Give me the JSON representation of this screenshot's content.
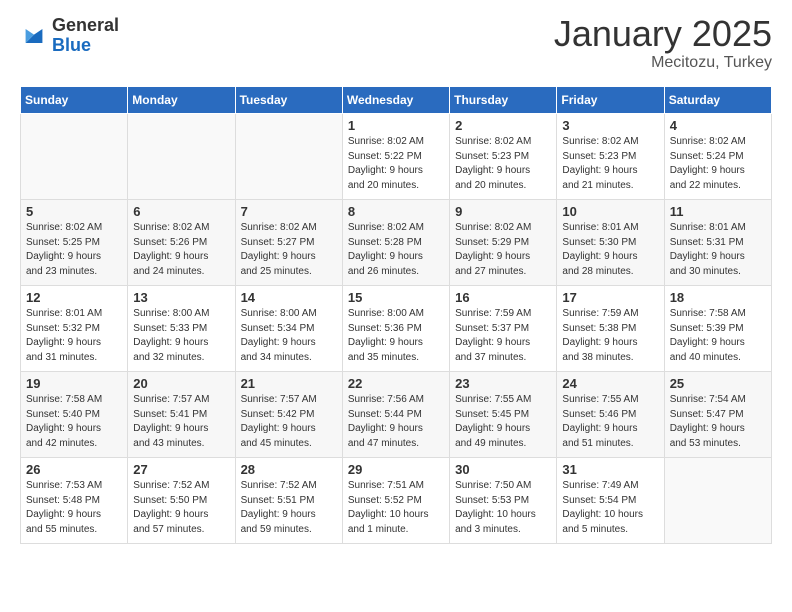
{
  "logo": {
    "general": "General",
    "blue": "Blue"
  },
  "title": "January 2025",
  "location": "Mecitozu, Turkey",
  "days_of_week": [
    "Sunday",
    "Monday",
    "Tuesday",
    "Wednesday",
    "Thursday",
    "Friday",
    "Saturday"
  ],
  "weeks": [
    [
      {
        "day": "",
        "info": ""
      },
      {
        "day": "",
        "info": ""
      },
      {
        "day": "",
        "info": ""
      },
      {
        "day": "1",
        "info": "Sunrise: 8:02 AM\nSunset: 5:22 PM\nDaylight: 9 hours\nand 20 minutes."
      },
      {
        "day": "2",
        "info": "Sunrise: 8:02 AM\nSunset: 5:23 PM\nDaylight: 9 hours\nand 20 minutes."
      },
      {
        "day": "3",
        "info": "Sunrise: 8:02 AM\nSunset: 5:23 PM\nDaylight: 9 hours\nand 21 minutes."
      },
      {
        "day": "4",
        "info": "Sunrise: 8:02 AM\nSunset: 5:24 PM\nDaylight: 9 hours\nand 22 minutes."
      }
    ],
    [
      {
        "day": "5",
        "info": "Sunrise: 8:02 AM\nSunset: 5:25 PM\nDaylight: 9 hours\nand 23 minutes."
      },
      {
        "day": "6",
        "info": "Sunrise: 8:02 AM\nSunset: 5:26 PM\nDaylight: 9 hours\nand 24 minutes."
      },
      {
        "day": "7",
        "info": "Sunrise: 8:02 AM\nSunset: 5:27 PM\nDaylight: 9 hours\nand 25 minutes."
      },
      {
        "day": "8",
        "info": "Sunrise: 8:02 AM\nSunset: 5:28 PM\nDaylight: 9 hours\nand 26 minutes."
      },
      {
        "day": "9",
        "info": "Sunrise: 8:02 AM\nSunset: 5:29 PM\nDaylight: 9 hours\nand 27 minutes."
      },
      {
        "day": "10",
        "info": "Sunrise: 8:01 AM\nSunset: 5:30 PM\nDaylight: 9 hours\nand 28 minutes."
      },
      {
        "day": "11",
        "info": "Sunrise: 8:01 AM\nSunset: 5:31 PM\nDaylight: 9 hours\nand 30 minutes."
      }
    ],
    [
      {
        "day": "12",
        "info": "Sunrise: 8:01 AM\nSunset: 5:32 PM\nDaylight: 9 hours\nand 31 minutes."
      },
      {
        "day": "13",
        "info": "Sunrise: 8:00 AM\nSunset: 5:33 PM\nDaylight: 9 hours\nand 32 minutes."
      },
      {
        "day": "14",
        "info": "Sunrise: 8:00 AM\nSunset: 5:34 PM\nDaylight: 9 hours\nand 34 minutes."
      },
      {
        "day": "15",
        "info": "Sunrise: 8:00 AM\nSunset: 5:36 PM\nDaylight: 9 hours\nand 35 minutes."
      },
      {
        "day": "16",
        "info": "Sunrise: 7:59 AM\nSunset: 5:37 PM\nDaylight: 9 hours\nand 37 minutes."
      },
      {
        "day": "17",
        "info": "Sunrise: 7:59 AM\nSunset: 5:38 PM\nDaylight: 9 hours\nand 38 minutes."
      },
      {
        "day": "18",
        "info": "Sunrise: 7:58 AM\nSunset: 5:39 PM\nDaylight: 9 hours\nand 40 minutes."
      }
    ],
    [
      {
        "day": "19",
        "info": "Sunrise: 7:58 AM\nSunset: 5:40 PM\nDaylight: 9 hours\nand 42 minutes."
      },
      {
        "day": "20",
        "info": "Sunrise: 7:57 AM\nSunset: 5:41 PM\nDaylight: 9 hours\nand 43 minutes."
      },
      {
        "day": "21",
        "info": "Sunrise: 7:57 AM\nSunset: 5:42 PM\nDaylight: 9 hours\nand 45 minutes."
      },
      {
        "day": "22",
        "info": "Sunrise: 7:56 AM\nSunset: 5:44 PM\nDaylight: 9 hours\nand 47 minutes."
      },
      {
        "day": "23",
        "info": "Sunrise: 7:55 AM\nSunset: 5:45 PM\nDaylight: 9 hours\nand 49 minutes."
      },
      {
        "day": "24",
        "info": "Sunrise: 7:55 AM\nSunset: 5:46 PM\nDaylight: 9 hours\nand 51 minutes."
      },
      {
        "day": "25",
        "info": "Sunrise: 7:54 AM\nSunset: 5:47 PM\nDaylight: 9 hours\nand 53 minutes."
      }
    ],
    [
      {
        "day": "26",
        "info": "Sunrise: 7:53 AM\nSunset: 5:48 PM\nDaylight: 9 hours\nand 55 minutes."
      },
      {
        "day": "27",
        "info": "Sunrise: 7:52 AM\nSunset: 5:50 PM\nDaylight: 9 hours\nand 57 minutes."
      },
      {
        "day": "28",
        "info": "Sunrise: 7:52 AM\nSunset: 5:51 PM\nDaylight: 9 hours\nand 59 minutes."
      },
      {
        "day": "29",
        "info": "Sunrise: 7:51 AM\nSunset: 5:52 PM\nDaylight: 10 hours\nand 1 minute."
      },
      {
        "day": "30",
        "info": "Sunrise: 7:50 AM\nSunset: 5:53 PM\nDaylight: 10 hours\nand 3 minutes."
      },
      {
        "day": "31",
        "info": "Sunrise: 7:49 AM\nSunset: 5:54 PM\nDaylight: 10 hours\nand 5 minutes."
      },
      {
        "day": "",
        "info": ""
      }
    ]
  ]
}
